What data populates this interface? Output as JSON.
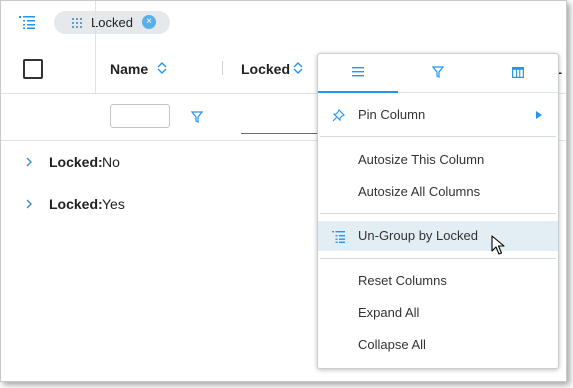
{
  "group_panel": {
    "chip_label": "Locked",
    "chip_close": "×"
  },
  "header": {
    "name_label": "Name",
    "locked_label": "Locked",
    "partial_label": "L"
  },
  "groups": [
    {
      "key": "Locked:",
      "value": "No"
    },
    {
      "key": "Locked:",
      "value": "Yes"
    }
  ],
  "column_menu": {
    "tabs": [
      {
        "icon": "menu-icon",
        "active": true
      },
      {
        "icon": "filter-icon",
        "active": false
      },
      {
        "icon": "columns-icon",
        "active": false
      }
    ],
    "items": {
      "pin": "Pin Column",
      "autosize_this": "Autosize This Column",
      "autosize_all": "Autosize All Columns",
      "ungroup": "Un-Group by Locked",
      "reset": "Reset Columns",
      "expand": "Expand All",
      "collapse": "Collapse All"
    }
  },
  "colors": {
    "accent": "#2196f3",
    "chip_bg": "#e5e9ec",
    "highlight": "#e3edf4"
  }
}
